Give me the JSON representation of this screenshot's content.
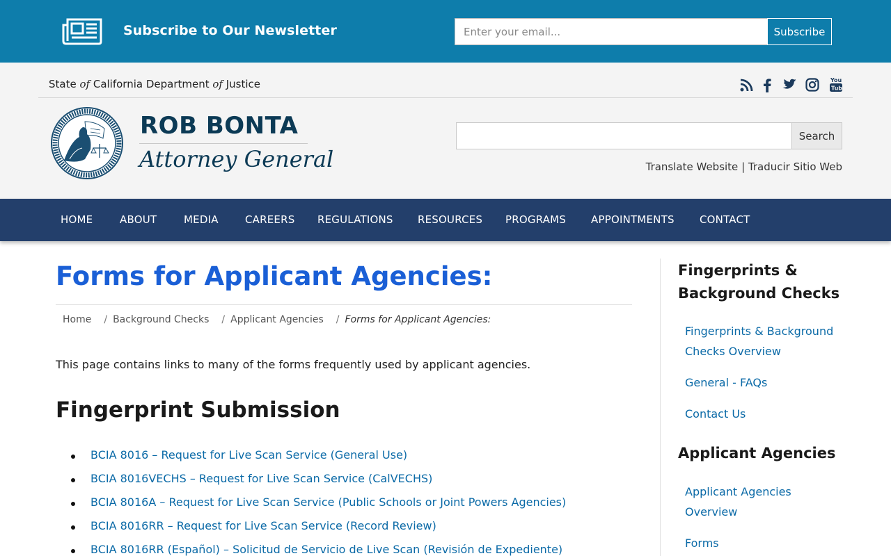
{
  "newsletter": {
    "title": "Subscribe to Our Newsletter",
    "email_placeholder": "Enter your email...",
    "button_label": "Subscribe",
    "icon": "newspaper-icon",
    "bg_color": "#0e7dab"
  },
  "header": {
    "state_line": {
      "part1": "State ",
      "of1": "of",
      "part2": " California Department ",
      "of2": "of",
      "part3": " Justice"
    },
    "social_icons": [
      "rss-icon",
      "facebook-icon",
      "twitter-icon",
      "instagram-icon",
      "youtube-icon"
    ],
    "seal_icon": "ag-seal-logo",
    "ag_name": "ROB BONTA",
    "ag_title": "Attorney General",
    "search_button": "Search",
    "translate": {
      "link1": "Translate Website",
      "separator": "|",
      "link2": "Traducir Sitio Web"
    }
  },
  "nav": {
    "bg_color": "#233f6b",
    "items": [
      "HOME",
      "ABOUT",
      "MEDIA",
      "CAREERS",
      "REGULATIONS",
      "RESOURCES",
      "PROGRAMS",
      "APPOINTMENTS",
      "CONTACT"
    ]
  },
  "main": {
    "title": "Forms for Applicant Agencies:",
    "title_color": "#1a5fd6",
    "breadcrumb": {
      "items": [
        "Home",
        "Background Checks",
        "Applicant Agencies"
      ],
      "current": "Forms for Applicant Agencies:",
      "separator": "/"
    },
    "intro": "This page contains links to many of the forms frequently used by applicant agencies.",
    "section_heading": "Fingerprint Submission",
    "forms": [
      "BCIA 8016 – Request for Live Scan Service (General Use)",
      "BCIA 8016VECHS – Request for Live Scan Service (CalVECHS)",
      "BCIA 8016A – Request for Live Scan Service (Public Schools or Joint Powers Agencies)",
      "BCIA 8016RR – Request for Live Scan Service (Record Review)",
      "BCIA 8016RR (Español) – Solicitud de Servicio de Live Scan (Revisión de Expediente)"
    ],
    "link_color": "#0b6aa7"
  },
  "sidebar": {
    "section1": {
      "heading": "Fingerprints & Background Checks",
      "links": [
        "Fingerprints & Background Checks Overview",
        "General - FAQs",
        "Contact Us"
      ]
    },
    "section2": {
      "heading": "Applicant Agencies",
      "links": [
        "Applicant Agencies Overview",
        "Forms"
      ]
    }
  }
}
